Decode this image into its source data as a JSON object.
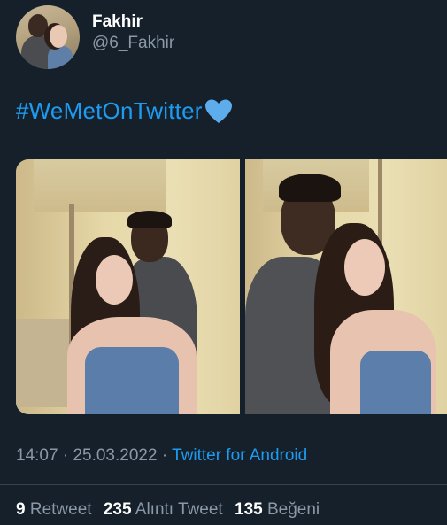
{
  "author": {
    "display_name": "Fakhir",
    "handle": "@6_Fakhir"
  },
  "tweet": {
    "text": "#WeMetOnTwitter",
    "emoji": "blue-heart-icon",
    "hashtag_color": "#1d9bf0"
  },
  "meta": {
    "time": "14:07",
    "separator": "·",
    "date": "25.03.2022",
    "source": "Twitter for Android"
  },
  "stats": {
    "retweets_count": "9",
    "retweets_label": "Retweet",
    "quotes_count": "235",
    "quotes_label": "Alıntı Tweet",
    "likes_count": "135",
    "likes_label": "Beğeni"
  },
  "theme": {
    "background": "#15202b",
    "secondary_text": "#8b98a5",
    "accent": "#1d9bf0",
    "divider": "#38444d"
  }
}
